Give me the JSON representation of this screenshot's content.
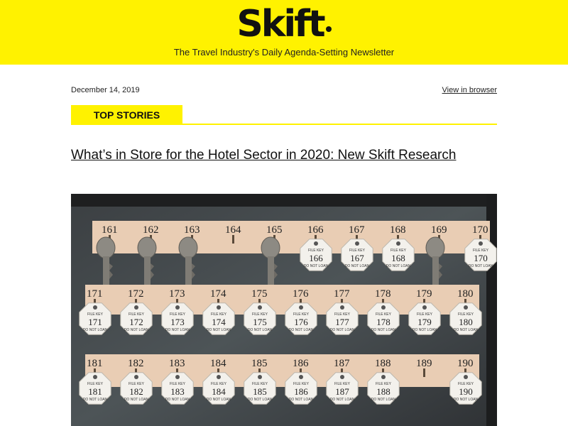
{
  "header": {
    "logo_text": "Skift",
    "tagline": "The Travel Industry's Daily Agenda-Setting Newsletter",
    "background_color": "#fff200"
  },
  "meta": {
    "date": "December 14, 2019",
    "view_in_browser": "View in browser"
  },
  "section": {
    "label": "TOP STORIES"
  },
  "story": {
    "headline": "What’s in Store for the Hotel Sector in 2020: New Skift Research"
  },
  "hero_image": {
    "rows": [
      {
        "numbers": [
          "161",
          "162",
          "163",
          "164",
          "165",
          "166",
          "167",
          "168",
          "169",
          "170"
        ],
        "tags": [
          "",
          "",
          "",
          "",
          "",
          "166",
          "167",
          "168",
          "",
          "170"
        ]
      },
      {
        "numbers": [
          "171",
          "172",
          "173",
          "174",
          "175",
          "176",
          "177",
          "178",
          "179",
          "180"
        ],
        "tags": [
          "171",
          "172",
          "173",
          "174",
          "175",
          "176",
          "177",
          "178",
          "179",
          "180"
        ]
      },
      {
        "numbers": [
          "181",
          "182",
          "183",
          "184",
          "185",
          "186",
          "187",
          "188",
          "189",
          "190"
        ],
        "tags": [
          "181",
          "182",
          "183",
          "184",
          "185",
          "186",
          "187",
          "188",
          "",
          "190"
        ]
      }
    ],
    "tag_label_top": "FILE KEY",
    "tag_label_bottom": "DO NOT LOAN"
  }
}
